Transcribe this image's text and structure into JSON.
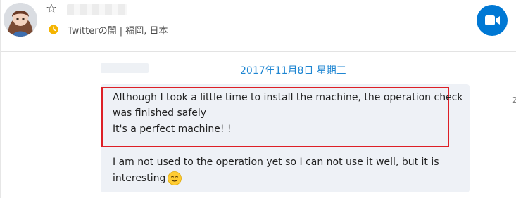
{
  "header": {
    "status_icon": "clock-icon",
    "status_text": "Twitterの闇 | 福岡, 日本",
    "star_icon": "star-outline-icon",
    "video_icon": "video-camera-icon",
    "accent_color": "#0078d4",
    "status_color": "#f5b400"
  },
  "conversation": {
    "date_label": "2017年11月8日 星期三",
    "side_mark": "2",
    "messages": [
      {
        "line1": "Although I took a little time to install the machine, the operation check",
        "line2": "was finished safely",
        "line3": "It's a perfect machine! !"
      },
      {
        "line1": "I am not used to the operation yet so I can not use it well, but it is",
        "line2": "interesting",
        "emoji": "smiling-face-emoji"
      }
    ],
    "highlight_color": "#dd1f26",
    "date_color": "#1f86d2"
  }
}
